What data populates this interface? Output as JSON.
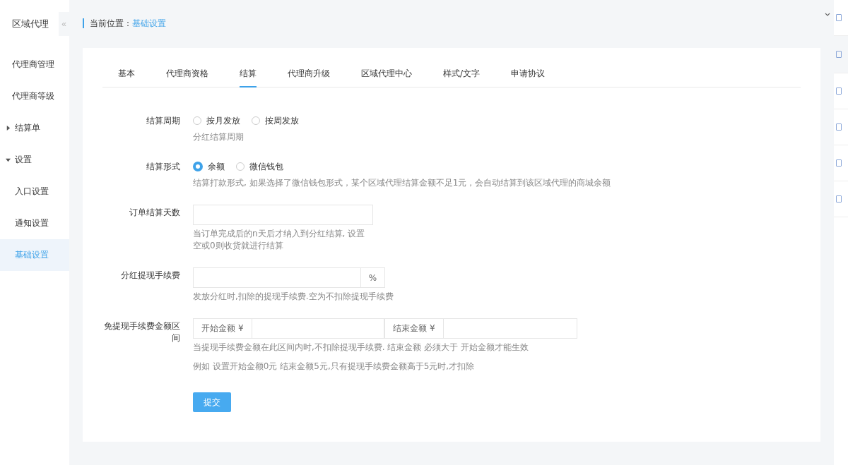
{
  "sidebar": {
    "title": "区域代理",
    "collapse_glyph": "«",
    "items": [
      {
        "label": "代理商管理",
        "selected": false
      },
      {
        "label": "代理商等级",
        "selected": false
      },
      {
        "label": "结算单",
        "selected": false,
        "expanded": false
      },
      {
        "label": "设置",
        "selected": false,
        "expanded": true,
        "children": [
          {
            "label": "入口设置",
            "selected": false
          },
          {
            "label": "通知设置",
            "selected": false
          },
          {
            "label": "基础设置",
            "selected": true
          }
        ]
      }
    ]
  },
  "breadcrumb": {
    "label": "当前位置：",
    "current": "基础设置"
  },
  "tabs": [
    {
      "label": "基本",
      "selected": false
    },
    {
      "label": "代理商资格",
      "selected": false
    },
    {
      "label": "结算",
      "selected": true
    },
    {
      "label": "代理商升级",
      "selected": false
    },
    {
      "label": "区域代理中心",
      "selected": false
    },
    {
      "label": "样式/文字",
      "selected": false
    },
    {
      "label": "申请协议",
      "selected": false
    }
  ],
  "form": [
    {
      "kind": "radio",
      "label": "结算周期",
      "options": [
        {
          "label": "按月发放",
          "selected": false
        },
        {
          "label": "按周发放",
          "selected": false
        }
      ],
      "hints": [
        "分红结算周期"
      ]
    },
    {
      "kind": "radio",
      "label": "结算形式",
      "options": [
        {
          "label": "余额",
          "selected": true
        },
        {
          "label": "微信钱包",
          "selected": false
        }
      ],
      "hints": [
        "结算打款形式, 如果选择了微信钱包形式，某个区域代理结算金额不足1元，会自动结算到该区域代理的商城余额"
      ]
    },
    {
      "kind": "text",
      "label": "订单结算天数",
      "hints": [
        "当订单完成后的n天后才纳入到分红结算, 设置",
        "空或0则收货就进行结算"
      ]
    },
    {
      "kind": "addon",
      "label": "分红提现手续费",
      "suffix": "%",
      "hints": [
        "发放分红时,扣除的提现手续费.空为不扣除提现手续费"
      ]
    },
    {
      "kind": "range",
      "label": "免提现手续费金额区间",
      "start_prefix": "开始金额 ¥",
      "end_prefix": "结束金额 ¥",
      "hints": [
        "当提现手续费金额在此区间内时,不扣除提现手续费. 结束金额 必须大于 开始金额才能生效",
        "例如 设置开始金额0元 结束金额5元,只有提现手续费金额高于5元时,才扣除"
      ]
    }
  ],
  "submit": "提交"
}
